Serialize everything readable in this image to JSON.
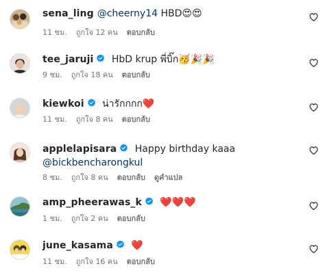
{
  "comments": [
    {
      "username": "sena_ling",
      "verified": false,
      "mention": "@cheerny14",
      "text": "HBD😍😍",
      "time": "11 ชม.",
      "likes": "ถูกใจ 12 คน",
      "reply": "ตอบกลับ"
    },
    {
      "username": "tee_jaruji",
      "verified": true,
      "text": "HbD krup พี่บิ๊ก🥳🎉🎉",
      "time": "9 ชม.",
      "likes": "ถูกใจ 18 คน",
      "reply": "ตอบกลับ"
    },
    {
      "username": "kiewkoi",
      "verified": true,
      "text": "น่ารักกกก❤️",
      "time": "11 ชม.",
      "likes": "ถูกใจ 8 คน",
      "reply": "ตอบกลับ"
    },
    {
      "username": "applelapisara",
      "verified": true,
      "text": "Happy birthday kaaa",
      "mention_line2": "@bickbencharongkul",
      "time": "8 ชม.",
      "likes": "ถูกใจ 8 คน",
      "reply": "ตอบกลับ",
      "translate": "ดูคำแปล"
    },
    {
      "username": "amp_pheerawas_k",
      "verified": true,
      "text": "❤️❤️❤️",
      "time": "1 ชม.",
      "likes": "ถูกใจ 2 คน",
      "reply": "ตอบกลับ"
    },
    {
      "username": "june_kasama",
      "verified": true,
      "text": "❤️",
      "time": "11 ชม.",
      "likes": "ถูกใจ 16 คน",
      "reply": "ตอบกลับ"
    }
  ],
  "icons": {
    "verified": "verified-badge-icon",
    "like": "heart-outline-icon"
  },
  "colors": {
    "verified": "#0095f6",
    "mention": "#00376b",
    "meta": "#737373",
    "text": "#262626"
  }
}
